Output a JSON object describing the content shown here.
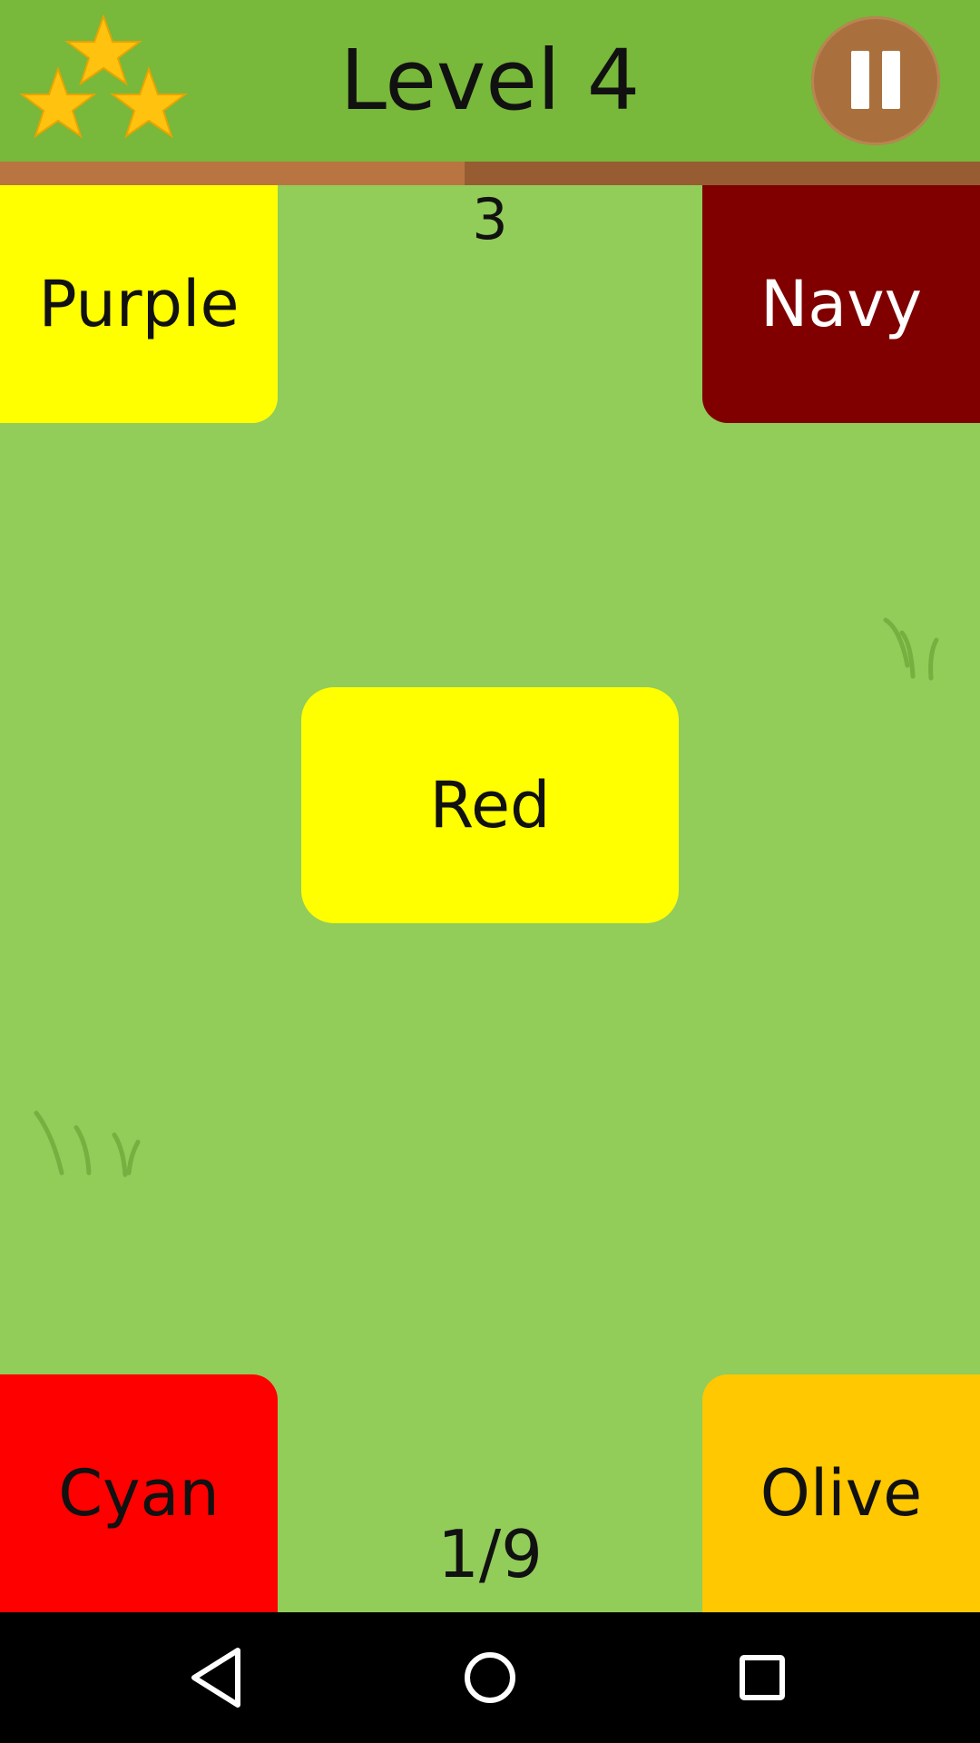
{
  "header": {
    "level_title": "Level 4",
    "stars_earned": 3,
    "stars_total": 3,
    "pause_icon": "pause-icon"
  },
  "timer": {
    "remaining_fraction": 0.474
  },
  "game": {
    "score": "3",
    "progress": "1/9",
    "center_word": {
      "label": "Red",
      "color": "#ffff00",
      "text_color": "#111111"
    },
    "options": [
      {
        "position": "top-left",
        "label": "Purple",
        "color": "#ffff00",
        "text_color": "#111111"
      },
      {
        "position": "top-right",
        "label": "Navy",
        "color": "#800000",
        "text_color": "#ffffff"
      },
      {
        "position": "bottom-left",
        "label": "Cyan",
        "color": "#ff0000",
        "text_color": "#111111"
      },
      {
        "position": "bottom-right",
        "label": "Olive",
        "color": "#ffc800",
        "text_color": "#111111"
      }
    ]
  },
  "colors": {
    "background": "#92cc59",
    "header": "#78b83a",
    "timer_fill": "#b97541",
    "timer_track": "#985c33",
    "pause_button": "#a9703d",
    "star": "#ffc20e"
  },
  "navbar": {
    "icons": [
      "back-triangle-icon",
      "home-circle-icon",
      "recents-square-icon"
    ]
  }
}
